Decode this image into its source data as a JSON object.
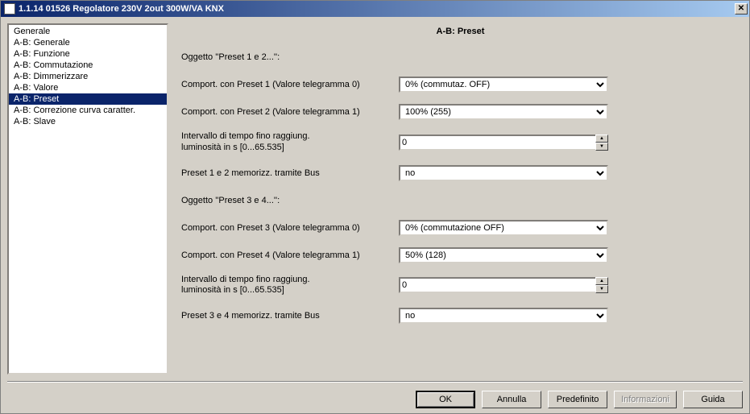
{
  "window": {
    "title": "1.1.14 01526 Regolatore 230V 2out 300W/VA KNX"
  },
  "sidebar": {
    "items": [
      "Generale",
      "A-B: Generale",
      "A-B: Funzione",
      "A-B: Commutazione",
      "A-B: Dimmerizzare",
      "A-B: Valore",
      "A-B: Preset",
      "A-B: Correzione curva caratter.",
      "A-B: Slave"
    ],
    "selected_index": 6
  },
  "main": {
    "title": "A-B: Preset",
    "section1_heading": "Oggetto ''Preset 1 e 2...'':",
    "row_preset1_label": "Comport. con Preset 1 (Valore telegramma 0)",
    "row_preset1_value": "0%    (commutaz. OFF)",
    "row_preset2_label": "Comport. con Preset 2 (Valore telegramma 1)",
    "row_preset2_value": "100% (255)",
    "row_interval12_label_l1": "Intervallo di tempo fino raggiung.",
    "row_interval12_label_l2": "luminosità  in s [0...65.535]",
    "row_interval12_value": "0",
    "row_mem12_label": " Preset 1 e 2 memorizz. tramite Bus",
    "row_mem12_value": "no",
    "section2_heading": "Oggetto ''Preset 3 e 4...'':",
    "row_preset3_label": "Comport. con Preset 3 (Valore telegramma 0)",
    "row_preset3_value": "0%    (commutazione OFF)",
    "row_preset4_label": "Comport. con Preset 4 (Valore telegramma 1)",
    "row_preset4_value": "50%  (128)",
    "row_interval34_label_l1": "Intervallo di tempo fino raggiung.",
    "row_interval34_label_l2": "luminosità  in s [0...65.535]",
    "row_interval34_value": "0",
    "row_mem34_label": " Preset 3 e 4 memorizz. tramite Bus",
    "row_mem34_value": "no"
  },
  "footer": {
    "ok": "OK",
    "cancel": "Annulla",
    "default": "Predefinito",
    "info": "Informazioni",
    "help": "Guida"
  }
}
